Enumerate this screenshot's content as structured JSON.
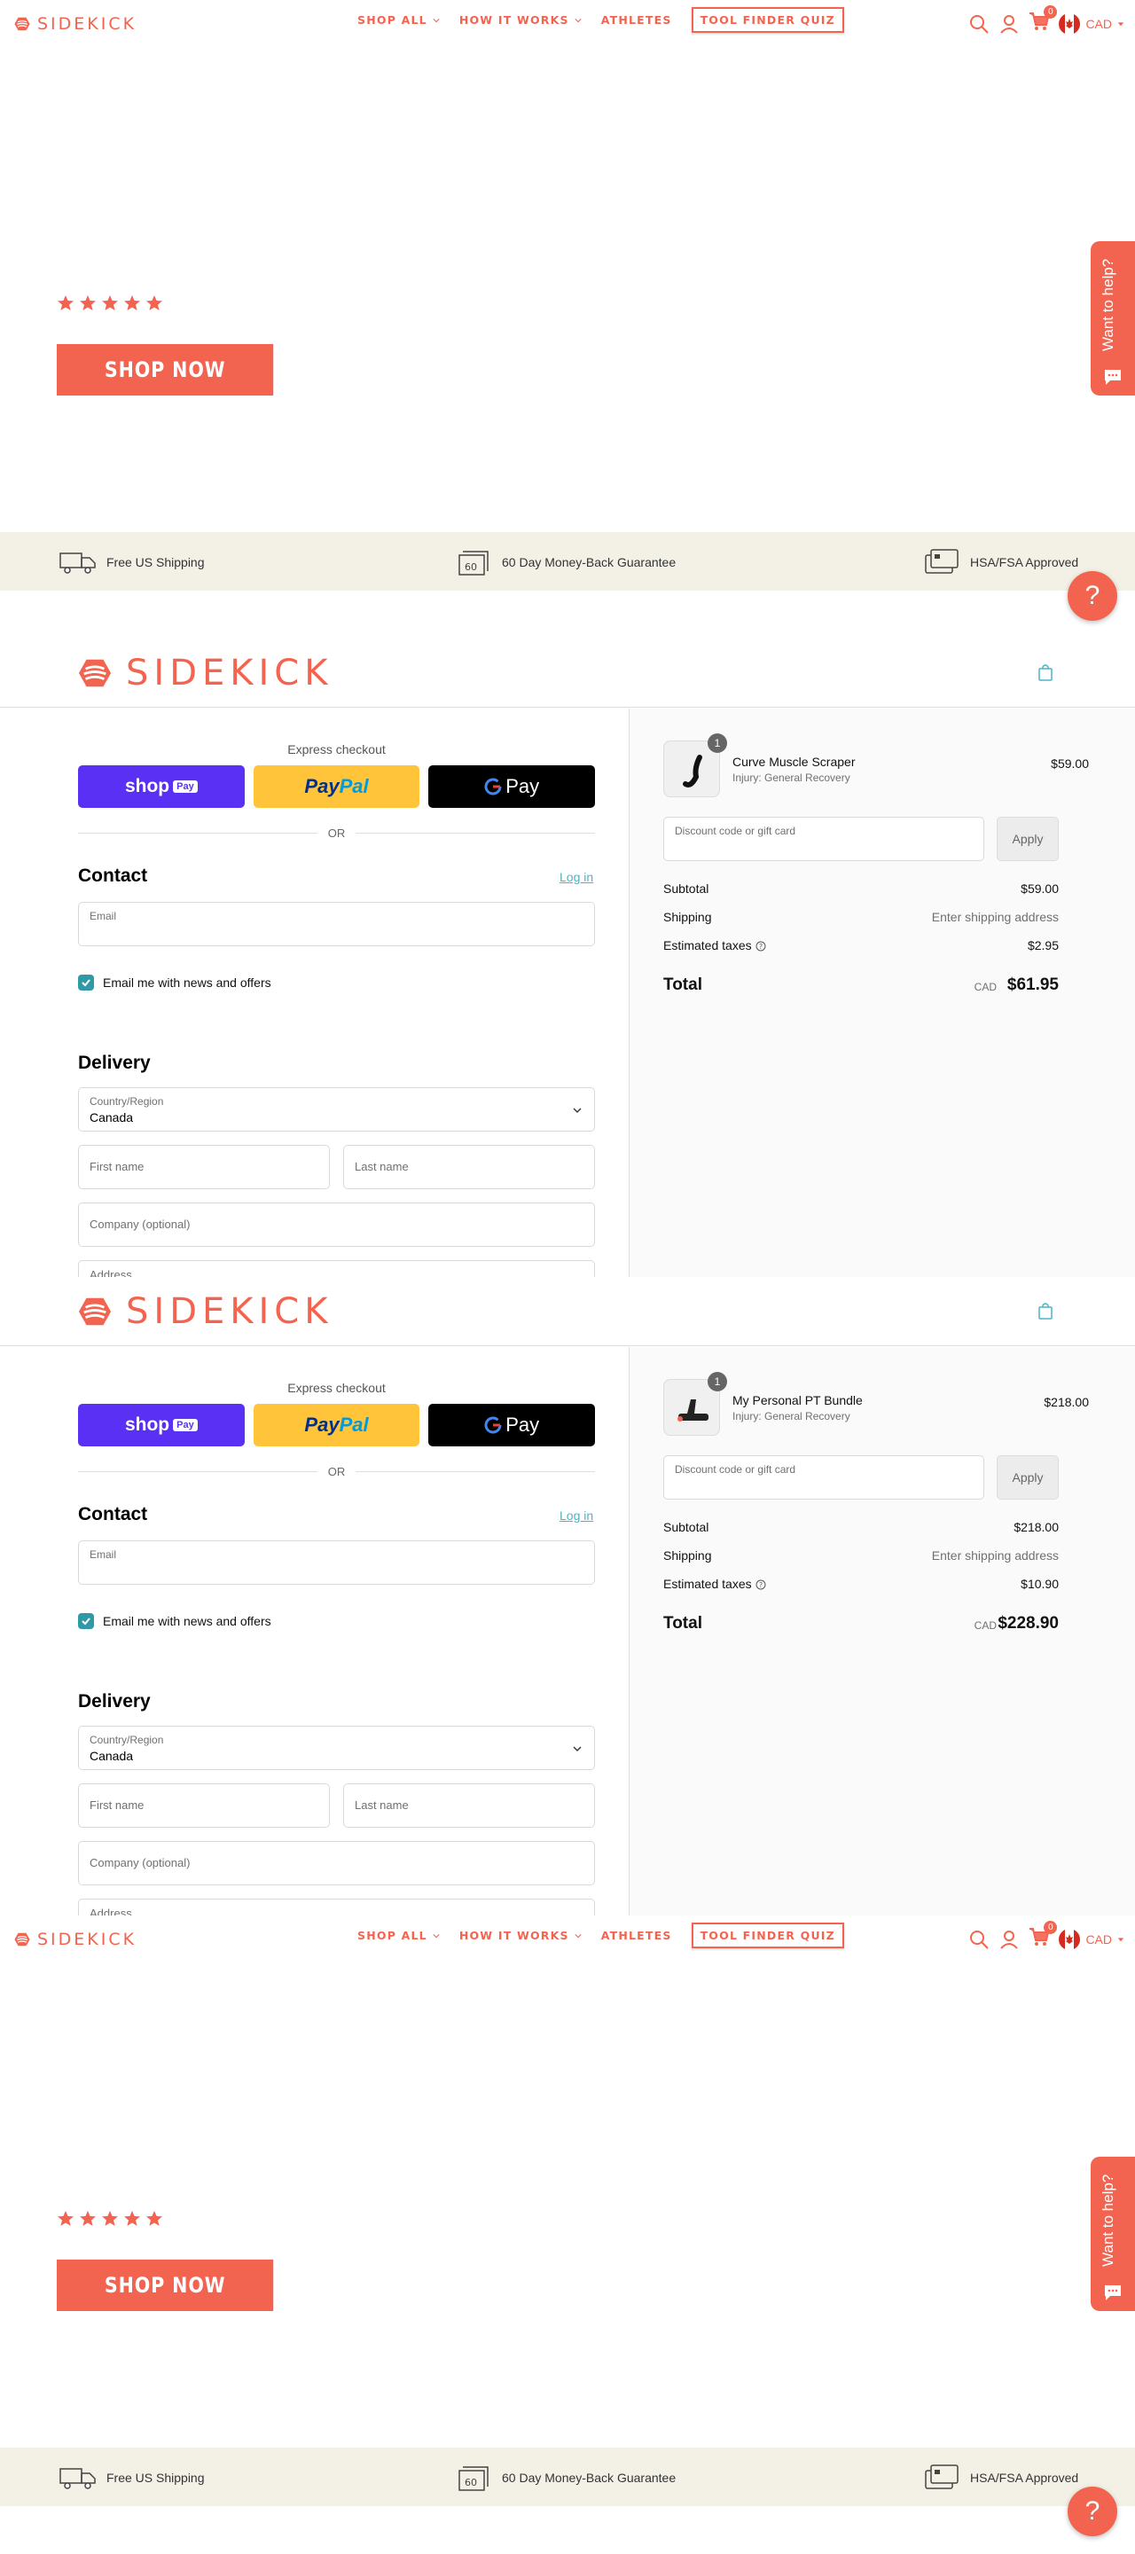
{
  "store": {
    "logo_text": "SIDEKICK",
    "nav": [
      "SHOP ALL",
      "HOW IT WORKS",
      "ATHLETES",
      "TOOL FINDER QUIZ"
    ],
    "cart_count": "0",
    "currency": "CAD",
    "shop_now": "SHOP NOW",
    "rating_stars": 5,
    "help_tab": "Want to help?",
    "benefits": [
      "Free US Shipping",
      "60 Day Money-Back Guarantee",
      "HSA/FSA Approved"
    ],
    "faq_button": "?"
  },
  "checkouts": [
    {
      "logo_text": "SIDEKICK",
      "express_title": "Express checkout",
      "shop_pay": "shop",
      "shop_pay_pill": "Pay",
      "paypal_a": "Pay",
      "paypal_b": "Pal",
      "gpay": "Pay",
      "or": "OR",
      "contact_title": "Contact",
      "login": "Log in",
      "email_label": "Email",
      "news_label": "Email me with news and offers",
      "delivery_title": "Delivery",
      "country_label": "Country/Region",
      "country_value": "Canada",
      "first_name": "First name",
      "last_name": "Last name",
      "company": "Company (optional)",
      "address": "Address",
      "item": {
        "qty": "1",
        "name": "Curve Muscle Scraper",
        "sub": "Injury: General Recovery",
        "price": "$59.00"
      },
      "discount_label": "Discount code or gift card",
      "apply": "Apply",
      "subtotal_label": "Subtotal",
      "subtotal": "$59.00",
      "shipping_label": "Shipping",
      "shipping": "Enter shipping address",
      "taxes_label": "Estimated taxes",
      "taxes": "$2.95",
      "total_label": "Total",
      "total_currency": "CAD",
      "total": "$61.95"
    },
    {
      "logo_text": "SIDEKICK",
      "express_title": "Express checkout",
      "shop_pay": "shop",
      "shop_pay_pill": "Pay",
      "paypal_a": "Pay",
      "paypal_b": "Pal",
      "gpay": "Pay",
      "or": "OR",
      "contact_title": "Contact",
      "login": "Log in",
      "email_label": "Email",
      "news_label": "Email me with news and offers",
      "delivery_title": "Delivery",
      "country_label": "Country/Region",
      "country_value": "Canada",
      "first_name": "First name",
      "last_name": "Last name",
      "company": "Company (optional)",
      "address": "Address",
      "item": {
        "qty": "1",
        "name": "My Personal PT Bundle",
        "sub": "Injury: General Recovery",
        "price": "$218.00"
      },
      "discount_label": "Discount code or gift card",
      "apply": "Apply",
      "subtotal_label": "Subtotal",
      "subtotal": "$218.00",
      "shipping_label": "Shipping",
      "shipping": "Enter shipping address",
      "taxes_label": "Estimated taxes",
      "taxes": "$10.90",
      "total_label": "Total",
      "total_currency": "CAD",
      "total": "$228.90"
    }
  ],
  "colors": {
    "brand": "#f26450",
    "shop_pay": "#5a31f4",
    "paypal": "#ffc439",
    "accent_teal": "#4cb4c9"
  }
}
